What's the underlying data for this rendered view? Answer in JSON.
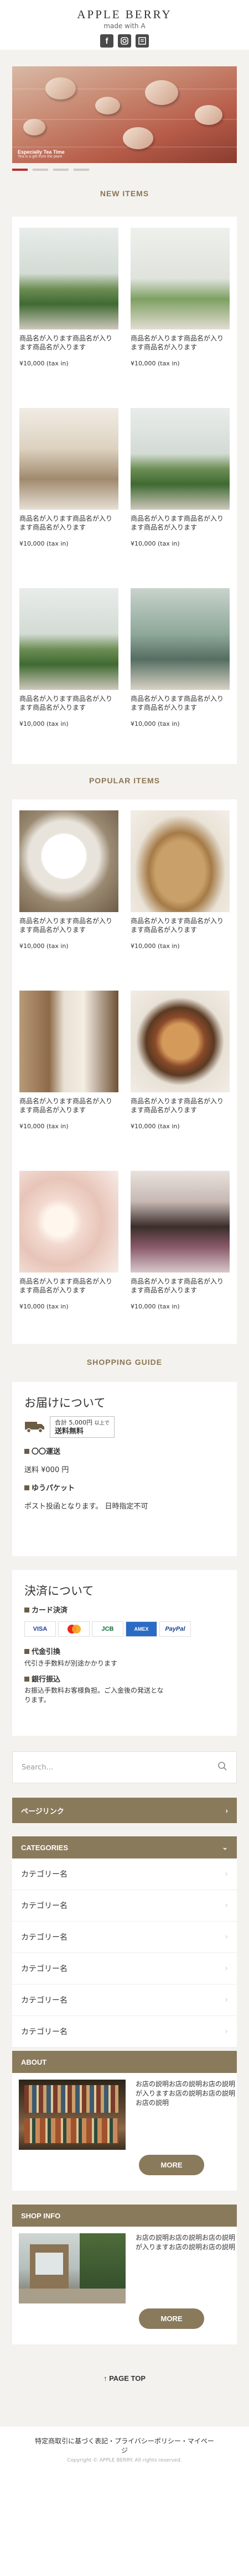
{
  "header": {
    "logo": "APPLE BERRY",
    "tagline": "made with A",
    "social_icons": [
      "facebook-icon",
      "instagram-icon",
      "blog-icon"
    ]
  },
  "hero": {
    "caption_title": "Especially Tea Time",
    "caption_sub": "Tea is a gift from the plant",
    "slide_count": 4,
    "active_slide": 1
  },
  "new_items": {
    "title": "NEW ITEMS",
    "items": [
      {
        "name": "商品名が入ります商品名が入ります商品名が入ります",
        "price": "¥10,000 (tax in)",
        "image": "plant-photo"
      },
      {
        "name": "商品名が入ります商品名が入ります商品名が入ります",
        "price": "¥10,000 (tax in)",
        "image": "birdcage-photo"
      },
      {
        "name": "商品名が入ります商品名が入ります商品名が入ります",
        "price": "¥10,000 (tax in)",
        "image": "chair-photo"
      },
      {
        "name": "商品名が入ります商品名が入ります商品名が入ります",
        "price": "¥10,000 (tax in)",
        "image": "plant-photo"
      },
      {
        "name": "商品名が入ります商品名が入ります商品名が入ります",
        "price": "¥10,000 (tax in)",
        "image": "plant-photo"
      },
      {
        "name": "商品名が入ります商品名が入ります商品名が入ります",
        "price": "¥10,000 (tax in)",
        "image": "jar-photo"
      }
    ]
  },
  "popular_items": {
    "title": "POPULAR ITEMS",
    "items": [
      {
        "name": "商品名が入ります商品名が入ります商品名が入ります",
        "price": "¥10,000 (tax in)",
        "image": "milk-photo"
      },
      {
        "name": "商品名が入ります商品名が入ります商品名が入ります",
        "price": "¥10,000 (tax in)",
        "image": "basket-photo"
      },
      {
        "name": "商品名が入ります商品名が入ります商品名が入ります",
        "price": "¥10,000 (tax in)",
        "image": "mug-photo"
      },
      {
        "name": "商品名が入ります商品名が入ります商品名が入ります",
        "price": "¥10,000 (tax in)",
        "image": "bread-photo"
      },
      {
        "name": "商品名が入ります商品名が入ります商品名が入ります",
        "price": "¥10,000 (tax in)",
        "image": "candle-photo"
      },
      {
        "name": "商品名が入ります商品名が入ります商品名が入ります",
        "price": "¥10,000 (tax in)",
        "image": "oil-photo"
      }
    ]
  },
  "shopping_guide": {
    "title": "SHOPPING GUIDE",
    "delivery": {
      "heading": "お届けについて",
      "badge_line1": "合計 5,000円",
      "badge_line1_suffix": "以上で",
      "badge_line2": "送料無料",
      "method1_title": "〇〇運送",
      "method1_text": "送料 ¥000 円",
      "method2_title": "ゆうパケット",
      "method2_text": "ポスト投函となります。 日時指定不可"
    },
    "payment": {
      "heading": "決済について",
      "card_title": "カード決済",
      "cards": [
        "VISA",
        "MC",
        "JCB",
        "AMEX",
        "PayPal"
      ],
      "cod_title": "代金引換",
      "cod_text": "代引き手数料が別途かかります",
      "bank_title": "銀行振込",
      "bank_text": "お振込手数料お客様負担。ご入金後の発送となります。"
    }
  },
  "search": {
    "placeholder": "Search..."
  },
  "page_links": {
    "label": "ページリンク"
  },
  "categories": {
    "title": "CATEGORIES",
    "items": [
      "カテゴリー名",
      "カテゴリー名",
      "カテゴリー名",
      "カテゴリー名",
      "カテゴリー名",
      "カテゴリー名"
    ]
  },
  "about": {
    "title": "ABOUT",
    "text": "お店の説明お店の説明お店の説明が入りますお店の説明お店の説明お店の説明",
    "more": "MORE"
  },
  "shop_info": {
    "title": "SHOP INFO",
    "text": "お店の説明お店の説明お店の説明が入りますお店の説明お店の説明",
    "more": "MORE"
  },
  "page_top": {
    "label": "↑ PAGE TOP"
  },
  "footer": {
    "links": "特定商取引に基づく表記・プライバシーポリシー・マイページ",
    "copyright": "Copyright © APPLE BERRY. All rights reserved."
  },
  "colors": {
    "accent": "#8a7a5c",
    "title": "#8a7553",
    "active_dot": "#b82e2e",
    "background": "#f4f2ee"
  }
}
